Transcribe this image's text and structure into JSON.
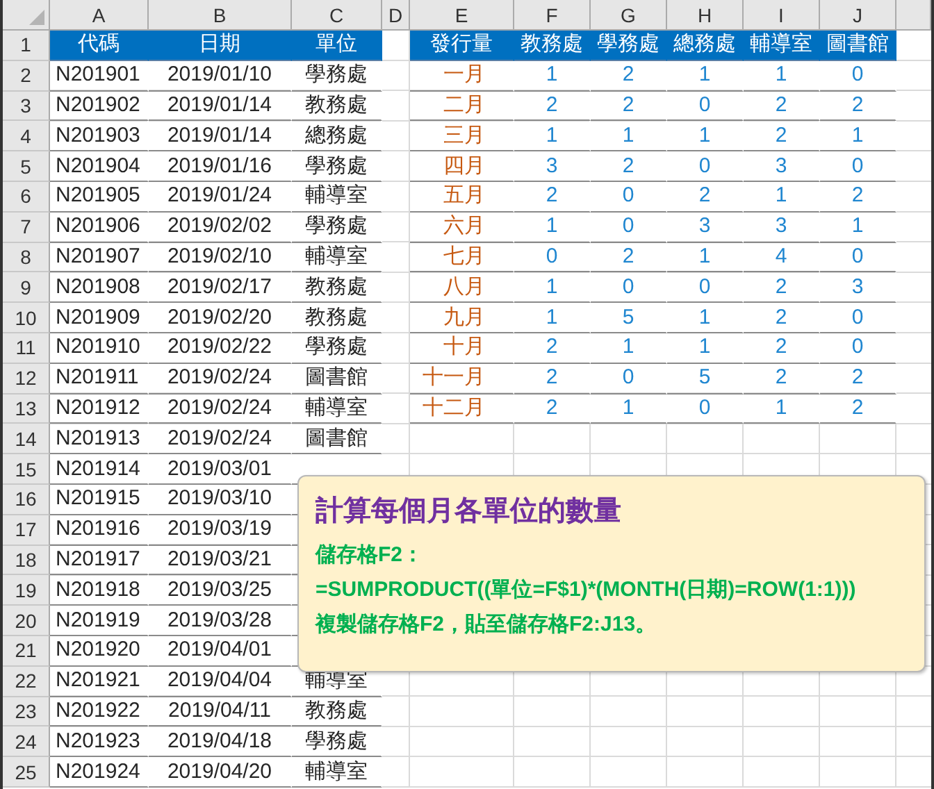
{
  "column_headers": [
    "A",
    "B",
    "C",
    "D",
    "E",
    "F",
    "G",
    "H",
    "I",
    "J"
  ],
  "row_numbers": [
    "1",
    "2",
    "3",
    "4",
    "5",
    "6",
    "7",
    "8",
    "9",
    "10",
    "11",
    "12",
    "13",
    "14",
    "15",
    "16",
    "17",
    "18",
    "19",
    "20",
    "21",
    "22",
    "23",
    "24",
    "25"
  ],
  "records": {
    "columns": [
      "代碼",
      "日期",
      "單位"
    ],
    "rows": [
      {
        "code": "N201901",
        "date": "2019/01/10",
        "unit": "學務處"
      },
      {
        "code": "N201902",
        "date": "2019/01/14",
        "unit": "教務處"
      },
      {
        "code": "N201903",
        "date": "2019/01/14",
        "unit": "總務處"
      },
      {
        "code": "N201904",
        "date": "2019/01/16",
        "unit": "學務處"
      },
      {
        "code": "N201905",
        "date": "2019/01/24",
        "unit": "輔導室"
      },
      {
        "code": "N201906",
        "date": "2019/02/02",
        "unit": "學務處"
      },
      {
        "code": "N201907",
        "date": "2019/02/10",
        "unit": "輔導室"
      },
      {
        "code": "N201908",
        "date": "2019/02/17",
        "unit": "教務處"
      },
      {
        "code": "N201909",
        "date": "2019/02/20",
        "unit": "教務處"
      },
      {
        "code": "N201910",
        "date": "2019/02/22",
        "unit": "學務處"
      },
      {
        "code": "N201911",
        "date": "2019/02/24",
        "unit": "圖書館"
      },
      {
        "code": "N201912",
        "date": "2019/02/24",
        "unit": "輔導室"
      },
      {
        "code": "N201913",
        "date": "2019/02/24",
        "unit": "圖書館"
      },
      {
        "code": "N201914",
        "date": "2019/03/01"
      },
      {
        "code": "N201915",
        "date": "2019/03/10"
      },
      {
        "code": "N201916",
        "date": "2019/03/19"
      },
      {
        "code": "N201917",
        "date": "2019/03/21"
      },
      {
        "code": "N201918",
        "date": "2019/03/25"
      },
      {
        "code": "N201919",
        "date": "2019/03/28"
      },
      {
        "code": "N201920",
        "date": "2019/04/01"
      },
      {
        "code": "N201921",
        "date": "2019/04/04",
        "unit": "輔導室"
      },
      {
        "code": "N201922",
        "date": "2019/04/11",
        "unit": "教務處"
      },
      {
        "code": "N201923",
        "date": "2019/04/18",
        "unit": "學務處"
      },
      {
        "code": "N201924",
        "date": "2019/04/20",
        "unit": "輔導室"
      }
    ]
  },
  "summary": {
    "columns": [
      "發行量",
      "教務處",
      "學務處",
      "總務處",
      "輔導室",
      "圖書館"
    ],
    "rows": [
      {
        "month": "一月",
        "values": [
          "1",
          "2",
          "1",
          "1",
          "0"
        ]
      },
      {
        "month": "二月",
        "values": [
          "2",
          "2",
          "0",
          "2",
          "2"
        ]
      },
      {
        "month": "三月",
        "values": [
          "1",
          "1",
          "1",
          "2",
          "1"
        ]
      },
      {
        "month": "四月",
        "values": [
          "3",
          "2",
          "0",
          "3",
          "0"
        ]
      },
      {
        "month": "五月",
        "values": [
          "2",
          "0",
          "2",
          "1",
          "2"
        ]
      },
      {
        "month": "六月",
        "values": [
          "1",
          "0",
          "3",
          "3",
          "1"
        ]
      },
      {
        "month": "七月",
        "values": [
          "0",
          "2",
          "1",
          "4",
          "0"
        ]
      },
      {
        "month": "八月",
        "values": [
          "1",
          "0",
          "0",
          "2",
          "3"
        ]
      },
      {
        "month": "九月",
        "values": [
          "1",
          "5",
          "1",
          "2",
          "0"
        ]
      },
      {
        "month": "十月",
        "values": [
          "2",
          "1",
          "1",
          "2",
          "0"
        ]
      },
      {
        "month": "十一月",
        "values": [
          "2",
          "0",
          "5",
          "2",
          "2"
        ]
      },
      {
        "month": "十二月",
        "values": [
          "2",
          "1",
          "0",
          "1",
          "2"
        ]
      }
    ]
  },
  "note": {
    "title": "計算每個月各單位的數量",
    "lines": [
      "儲存格F2：",
      "=SUMPRODUCT((單位=F$1)*(MONTH(日期)=ROW(1:1)))",
      "複製儲存格F2，貼至儲存格F2:J13。"
    ]
  }
}
